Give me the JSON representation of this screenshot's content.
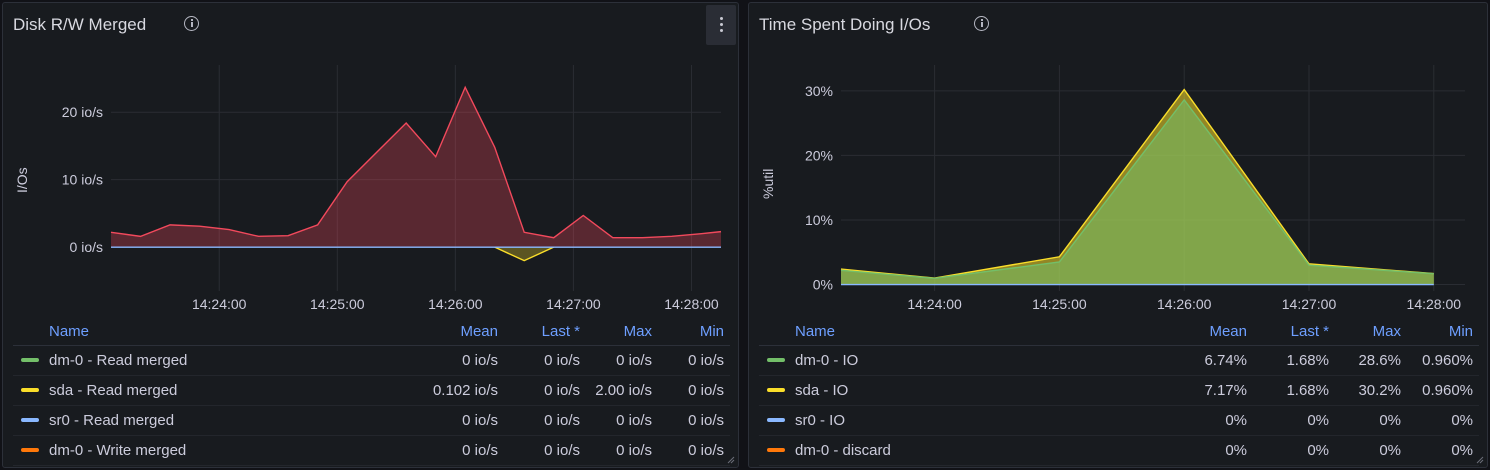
{
  "panels": [
    {
      "title": "Disk R/W Merged",
      "y_axis_label": "I/Os",
      "legend_headers": {
        "name": "Name",
        "mean": "Mean",
        "last": "Last *",
        "max": "Max",
        "min": "Min"
      },
      "legend_rows": [
        {
          "name": "dm-0 - Read merged",
          "color": "#73bf69",
          "mean": "0 io/s",
          "last": "0 io/s",
          "max": "0 io/s",
          "min": "0 io/s"
        },
        {
          "name": "sda - Read merged",
          "color": "#fade2a",
          "mean": "0.102 io/s",
          "last": "0 io/s",
          "max": "2.00 io/s",
          "min": "0 io/s"
        },
        {
          "name": "sr0 - Read merged",
          "color": "#8ab8ff",
          "mean": "0 io/s",
          "last": "0 io/s",
          "max": "0 io/s",
          "min": "0 io/s"
        },
        {
          "name": "dm-0 - Write merged",
          "color": "#ff780a",
          "mean": "0 io/s",
          "last": "0 io/s",
          "max": "0 io/s",
          "min": "0 io/s"
        }
      ]
    },
    {
      "title": "Time Spent Doing I/Os",
      "y_axis_label": "%util",
      "legend_headers": {
        "name": "Name",
        "mean": "Mean",
        "last": "Last *",
        "max": "Max",
        "min": "Min"
      },
      "legend_rows": [
        {
          "name": "dm-0 - IO",
          "color": "#73bf69",
          "mean": "6.74%",
          "last": "1.68%",
          "max": "28.6%",
          "min": "0.960%"
        },
        {
          "name": "sda - IO",
          "color": "#fade2a",
          "mean": "7.17%",
          "last": "1.68%",
          "max": "30.2%",
          "min": "0.960%"
        },
        {
          "name": "sr0 - IO",
          "color": "#8ab8ff",
          "mean": "0%",
          "last": "0%",
          "max": "0%",
          "min": "0%"
        },
        {
          "name": "dm-0 - discard",
          "color": "#ff780a",
          "mean": "0%",
          "last": "0%",
          "max": "0%",
          "min": "0%"
        }
      ]
    }
  ],
  "chart_data": [
    {
      "type": "area",
      "title": "Disk R/W Merged",
      "ylabel": "I/Os",
      "unit": "io/s",
      "x_ticks": [
        "14:24:00",
        "14:25:00",
        "14:26:00",
        "14:27:00",
        "14:28:00"
      ],
      "y_ticks": [
        "0 io/s",
        "10 io/s",
        "20 io/s"
      ],
      "xlim": [
        "14:23:05",
        "14:28:15"
      ],
      "ylim": [
        -6.5,
        27
      ],
      "grid": true,
      "legend_position": "bottom",
      "series": [
        {
          "name": "dm-0 - Write merged",
          "color": "#f2495c",
          "x": [
            "14:23:05",
            "14:23:20",
            "14:23:35",
            "14:23:50",
            "14:24:05",
            "14:24:20",
            "14:24:35",
            "14:24:50",
            "14:25:05",
            "14:25:35",
            "14:25:50",
            "14:26:05",
            "14:26:20",
            "14:26:35",
            "14:26:50",
            "14:27:05",
            "14:27:20",
            "14:27:35",
            "14:27:50",
            "14:28:05",
            "14:28:15"
          ],
          "values": [
            2.2,
            1.6,
            3.3,
            3.1,
            2.6,
            1.6,
            1.7,
            3.3,
            9.7,
            18.4,
            13.4,
            23.7,
            14.8,
            2.2,
            1.4,
            4.7,
            1.4,
            1.4,
            1.6,
            2.0,
            2.3
          ]
        },
        {
          "name": "sda - Read merged",
          "color": "#fade2a",
          "x": [
            "14:26:20",
            "14:26:35",
            "14:26:50"
          ],
          "values": [
            0,
            -2.0,
            0
          ]
        },
        {
          "name": "sr0 - Read merged",
          "color": "#8ab8ff",
          "x": [
            "14:23:05",
            "14:28:15"
          ],
          "values": [
            0,
            0
          ]
        }
      ]
    },
    {
      "type": "area",
      "title": "Time Spent Doing I/Os",
      "ylabel": "%util",
      "unit": "%",
      "x_ticks": [
        "14:24:00",
        "14:25:00",
        "14:26:00",
        "14:27:00",
        "14:28:00"
      ],
      "y_ticks": [
        "0%",
        "10%",
        "20%",
        "30%"
      ],
      "xlim": [
        "14:23:15",
        "14:28:15"
      ],
      "ylim": [
        -1,
        34
      ],
      "grid": true,
      "legend_position": "bottom",
      "series": [
        {
          "name": "sda - IO",
          "color": "#fade2a",
          "x": [
            "14:23:15",
            "14:24:00",
            "14:25:00",
            "14:26:00",
            "14:27:00",
            "14:28:00"
          ],
          "values": [
            2.4,
            1.0,
            4.3,
            30.2,
            3.2,
            1.7
          ]
        },
        {
          "name": "dm-0 - IO",
          "color": "#73bf69",
          "x": [
            "14:23:15",
            "14:24:00",
            "14:25:00",
            "14:26:00",
            "14:27:00",
            "14:28:00"
          ],
          "values": [
            2.2,
            0.96,
            3.5,
            28.6,
            3.0,
            1.68
          ]
        },
        {
          "name": "sr0 - IO",
          "color": "#8ab8ff",
          "x": [
            "14:23:15",
            "14:28:00"
          ],
          "values": [
            0,
            0
          ]
        }
      ]
    }
  ]
}
